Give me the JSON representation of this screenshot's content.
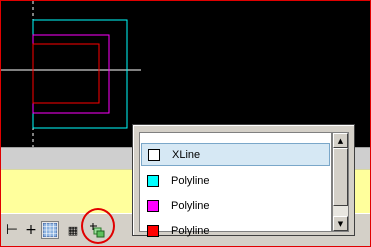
{
  "layers_dropdown": {
    "items": [
      {
        "label": "XLine",
        "color": "#ffffff",
        "selected": true
      },
      {
        "label": "Polyline",
        "color": "#00ffff",
        "selected": false
      },
      {
        "label": "Polyline",
        "color": "#ff00ff",
        "selected": false
      },
      {
        "label": "Polyline",
        "color": "#ff0000",
        "selected": false
      }
    ]
  },
  "statusbar": {
    "buttons": [
      {
        "name": "ortho-icon",
        "glyph": "⊢"
      },
      {
        "name": "crosshair-icon",
        "glyph": "+"
      },
      {
        "name": "grid-icon",
        "glyph": ""
      },
      {
        "name": "calculator-icon",
        "glyph": "▦"
      },
      {
        "name": "layer-icon",
        "glyph": ""
      }
    ]
  },
  "colors": {
    "canvas": "#000000",
    "command_bg": "#ffff9c",
    "annotation": "#e00000"
  }
}
